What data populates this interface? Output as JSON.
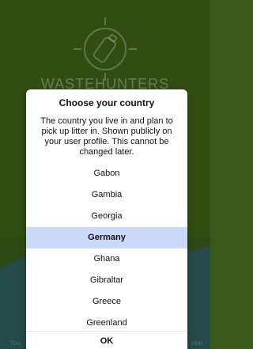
{
  "app": {
    "brand": "WASTEHUNTERS",
    "footer_left": "You",
    "footer_right": "rate",
    "logo_icon": "bottle-target-icon"
  },
  "dialog": {
    "title": "Choose your country",
    "description": "The country you live in and plan to pick up litter in. Shown publicly on your user profile. This cannot be changed later.",
    "countries": [
      "Gabon",
      "Gambia",
      "Georgia",
      "Germany",
      "Ghana",
      "Gibraltar",
      "Greece",
      "Greenland"
    ],
    "selected": "Germany",
    "ok_label": "OK"
  },
  "colors": {
    "background_green": "#3e5f16",
    "wave_teal": "#2c5b59",
    "selection": "#ccd9f8"
  }
}
